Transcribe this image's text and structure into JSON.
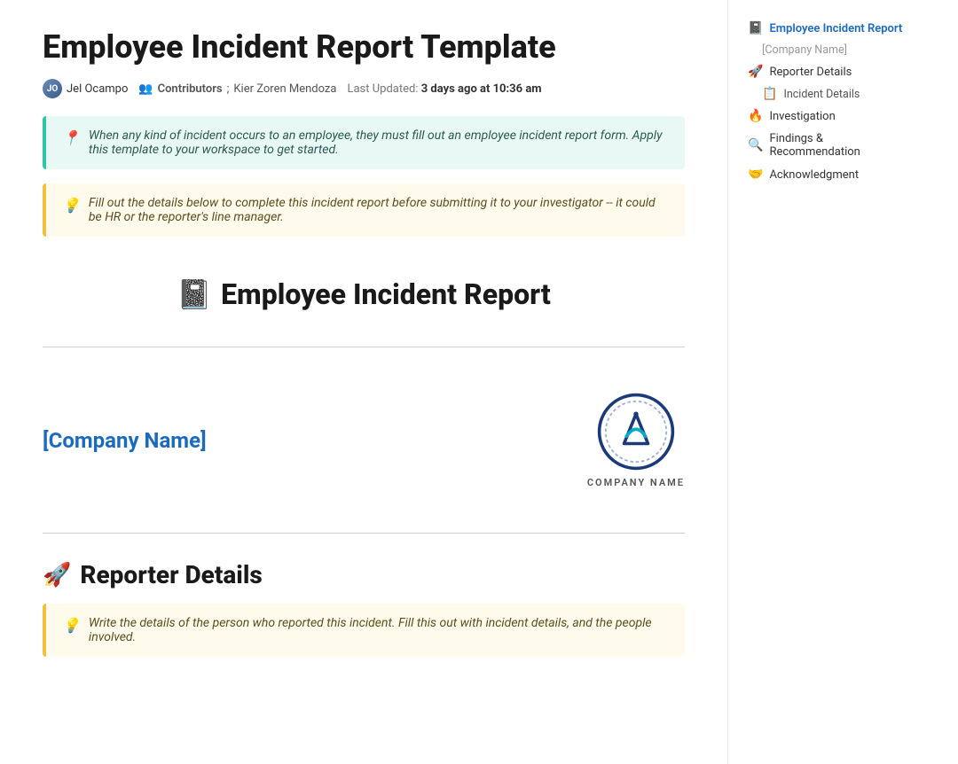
{
  "page": {
    "title": "Employee Incident Report Template",
    "author": "Jel Ocampo",
    "author_initials": "JO",
    "contributors_label": "Contributors",
    "contributors": "Kier Zoren Mendoza",
    "last_updated_label": "Last Updated:",
    "last_updated_value": "3 days ago at 10:36 am"
  },
  "callouts": {
    "green_icon": "📍",
    "green_text": "When any kind of incident occurs to an employee, they must fill out an employee incident report form. Apply this template to your workspace to get started.",
    "yellow_icon": "💡",
    "yellow_text": "Fill out the details below to complete this incident report before submitting it to your investigator -- it could be HR or the reporter's line manager."
  },
  "report": {
    "icon": "📓",
    "title": "Employee Incident Report",
    "company_name": "[Company Name]",
    "company_logo_label": "COMPANY NAME"
  },
  "reporter_section": {
    "icon": "🚀",
    "title": "Reporter Details",
    "callout_icon": "💡",
    "callout_text": "Write the details of the person who reported this incident. Fill this out with incident details, and the people involved."
  },
  "sidebar": {
    "items": [
      {
        "id": "employee-incident-report",
        "icon": "📓",
        "label": "Employee Incident Report",
        "active": true,
        "indent": 0
      },
      {
        "id": "company-name",
        "icon": "",
        "label": "[Company Name]",
        "active": false,
        "indent": 1,
        "placeholder": true
      },
      {
        "id": "reporter-details",
        "icon": "🚀",
        "label": "Reporter Details",
        "active": false,
        "indent": 0
      },
      {
        "id": "incident-details",
        "icon": "📋",
        "label": "Incident Details",
        "active": false,
        "indent": 1
      },
      {
        "id": "investigation",
        "icon": "🔥",
        "label": "Investigation",
        "active": false,
        "indent": 0
      },
      {
        "id": "findings-recommendation",
        "icon": "🔍",
        "label": "Findings & Recommendation",
        "active": false,
        "indent": 0
      },
      {
        "id": "acknowledgment",
        "icon": "🤝",
        "label": "Acknowledgment",
        "active": false,
        "indent": 0
      }
    ]
  }
}
